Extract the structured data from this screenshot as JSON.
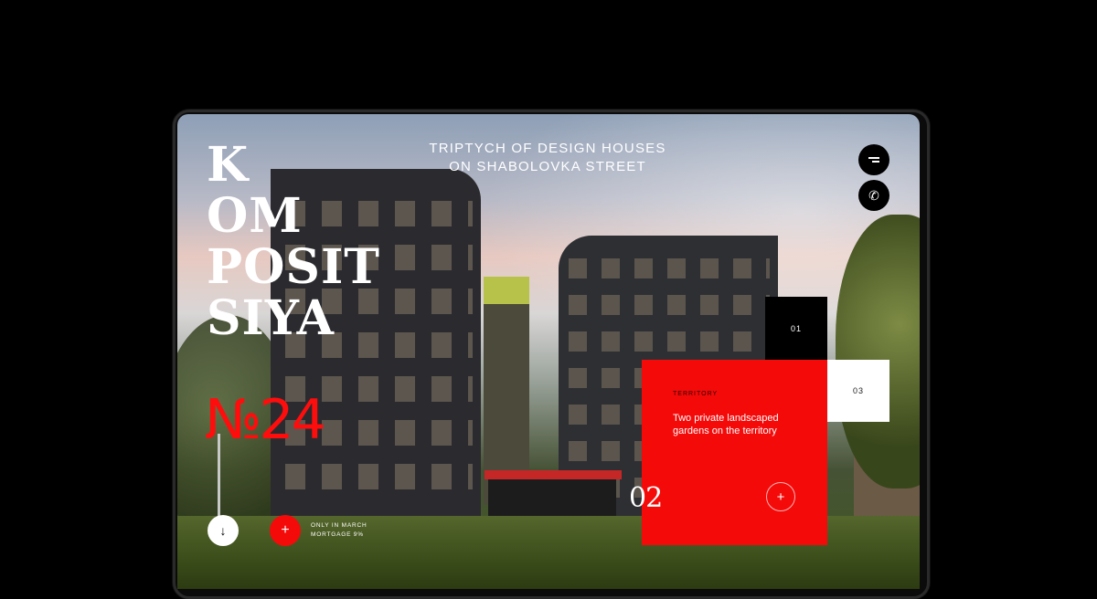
{
  "brand": {
    "logo_lines": [
      "K",
      "OM",
      "POSIT",
      "SIYA"
    ],
    "logo_number": "№24"
  },
  "header": {
    "tagline_line1": "TRIPTYCH OF DESIGN HOUSES",
    "tagline_line2": "ON SHABOLOVKA STREET"
  },
  "controls": {
    "menu_icon": "menu-icon",
    "phone_icon": "phone-icon",
    "phone_glyph": "✆",
    "scroll_glyph": "↓",
    "plus_glyph": "+"
  },
  "tiles": {
    "tile_1": "01",
    "tile_3": "03"
  },
  "feature_card": {
    "label": "TERRITORY",
    "text": "Two private landscaped gardens on the territory",
    "number": "02",
    "plus_glyph": "+"
  },
  "promo": {
    "line1": "ONLY IN MARCH",
    "line2": "MORTGAGE 9%"
  },
  "colors": {
    "accent": "#f50a0a",
    "background": "#000000",
    "text_light": "#ffffff"
  }
}
